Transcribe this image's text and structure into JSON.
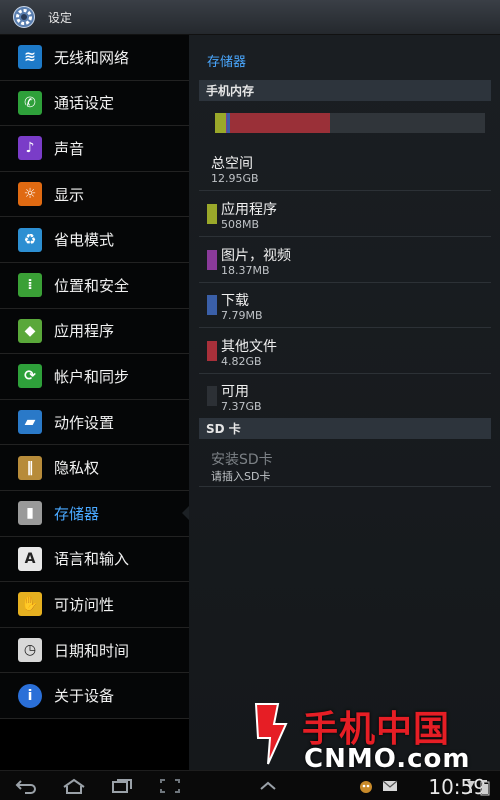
{
  "titlebar": {
    "title": "设定",
    "icon": "settings-gear-icon"
  },
  "sidebar": {
    "items": [
      {
        "label": "无线和网络",
        "icon": "wifi-icon",
        "color": "#1e7ac8"
      },
      {
        "label": "通话设定",
        "icon": "phone-icon",
        "color": "#2ea03a"
      },
      {
        "label": "声音",
        "icon": "speaker-icon",
        "color": "#7a3cc8"
      },
      {
        "label": "显示",
        "icon": "brightness-icon",
        "color": "#e06a12"
      },
      {
        "label": "省电模式",
        "icon": "battery-recycle-icon",
        "color": "#2d8fd2"
      },
      {
        "label": "位置和安全",
        "icon": "location-grid-icon",
        "color": "#3aa036"
      },
      {
        "label": "应用程序",
        "icon": "android-icon",
        "color": "#5aa83a"
      },
      {
        "label": "帐户和同步",
        "icon": "sync-icon",
        "color": "#2ea03a"
      },
      {
        "label": "动作设置",
        "icon": "motion-icon",
        "color": "#2a79c8"
      },
      {
        "label": "隐私权",
        "icon": "fence-icon",
        "color": "#b78b3a"
      },
      {
        "label": "存储器",
        "icon": "sdcard-icon",
        "color": "#9a9a9a",
        "active": true
      },
      {
        "label": "语言和输入",
        "icon": "keyboard-a-icon",
        "color": "#e8e8e8"
      },
      {
        "label": "可访问性",
        "icon": "hand-icon",
        "color": "#e6b020"
      },
      {
        "label": "日期和时间",
        "icon": "clock-icon",
        "color": "#d8d8d8"
      },
      {
        "label": "关于设备",
        "icon": "info-icon",
        "color": "#2a6fd8"
      }
    ]
  },
  "main": {
    "title": "存储器",
    "phone_section": "手机内存",
    "usage_bar": [
      {
        "name": "应用程序",
        "fraction": 0.04,
        "color": "#9aa82a"
      },
      {
        "name": "图片，视频",
        "fraction": 0.005,
        "color": "#7a3c9a"
      },
      {
        "name": "下载",
        "fraction": 0.01,
        "color": "#3a5fa8"
      },
      {
        "name": "其他文件",
        "fraction": 0.37,
        "color": "#9a3038"
      },
      {
        "name": "可用",
        "fraction": 0.575,
        "color": "#30353a"
      }
    ],
    "total": {
      "label": "总空间",
      "value": "12.95GB"
    },
    "rows": [
      {
        "label": "应用程序",
        "value": "508MB",
        "color": "#9aa82a"
      },
      {
        "label": "图片，视频",
        "value": "18.37MB",
        "color": "#8a3a9a"
      },
      {
        "label": "下载",
        "value": "7.79MB",
        "color": "#3a5fa8"
      },
      {
        "label": "其他文件",
        "value": "4.82GB",
        "color": "#a8303a"
      },
      {
        "label": "可用",
        "value": "7.37GB",
        "color": "#2c3035"
      }
    ],
    "sd_section": "SD 卡",
    "sd_install": {
      "label": "安装SD卡",
      "sub": "请插入SD卡"
    }
  },
  "navbar": {
    "back": "back-icon",
    "home": "home-icon",
    "recent": "recent-apps-icon",
    "screenshot": "screenshot-icon",
    "up": "chevron-up-icon",
    "time": "10:59"
  },
  "watermark": {
    "cn": "手机中国",
    "en": "CNMO.com"
  }
}
